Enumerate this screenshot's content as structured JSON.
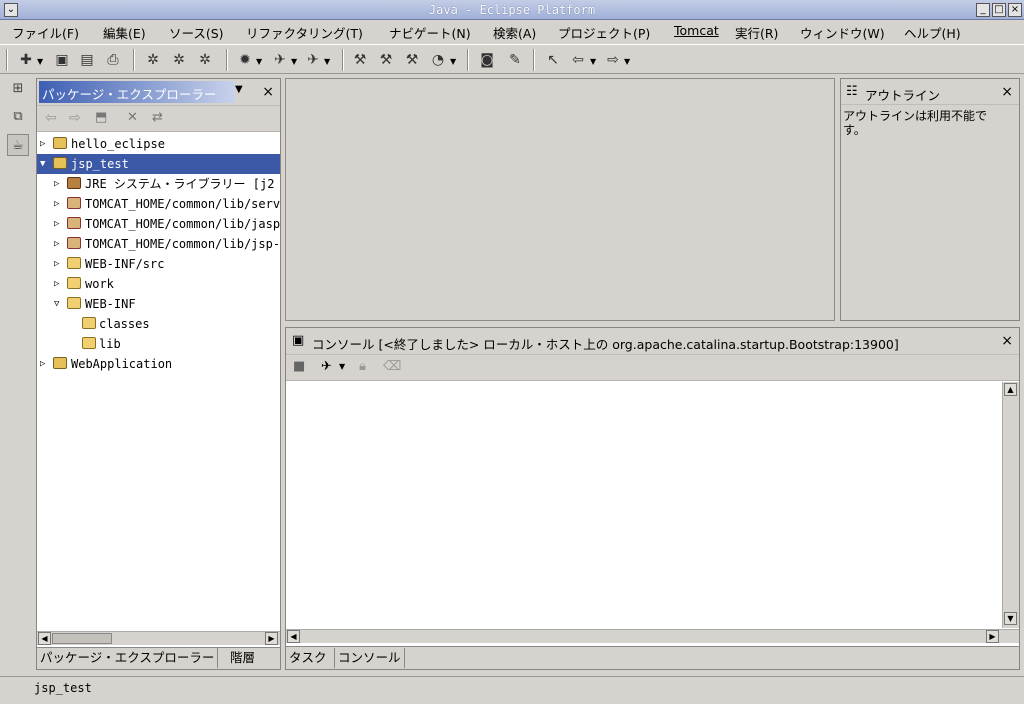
{
  "window": {
    "title": "Java - Eclipse Platform"
  },
  "menubar": {
    "items": [
      "ファイル(F)",
      "編集(E)",
      "ソース(S)",
      "リファクタリング(T)",
      "ナビゲート(N)",
      "検索(A)",
      "プロジェクト(P)",
      "Tomcat",
      "実行(R)",
      "ウィンドウ(W)",
      "ヘルプ(H)"
    ]
  },
  "package_explorer": {
    "title": "パッケージ・エクスプローラー",
    "tree": [
      {
        "label": "hello_eclipse",
        "level": 0,
        "expanded": false,
        "icon": "project-folder-icon"
      },
      {
        "label": "jsp_test",
        "level": 0,
        "expanded": true,
        "selected": true,
        "icon": "project-folder-icon"
      },
      {
        "label": "JRE システム・ライブラリー [j2",
        "level": 1,
        "expanded": false,
        "icon": "library-icon"
      },
      {
        "label": "TOMCAT_HOME/common/lib/servl",
        "level": 1,
        "expanded": false,
        "icon": "jar-icon"
      },
      {
        "label": "TOMCAT_HOME/common/lib/jaspe",
        "level": 1,
        "expanded": false,
        "icon": "jar-icon"
      },
      {
        "label": "TOMCAT_HOME/common/lib/jsp-a",
        "level": 1,
        "expanded": false,
        "icon": "jar-icon"
      },
      {
        "label": "WEB-INF/src",
        "level": 1,
        "expanded": false,
        "icon": "package-folder-icon"
      },
      {
        "label": "work",
        "level": 1,
        "expanded": false,
        "icon": "package-folder-icon"
      },
      {
        "label": "WEB-INF",
        "level": 1,
        "expanded": true,
        "icon": "open-folder-icon"
      },
      {
        "label": "classes",
        "level": 2,
        "icon": "folder-icon"
      },
      {
        "label": "lib",
        "level": 2,
        "icon": "folder-icon"
      },
      {
        "label": "WebApplication",
        "level": 0,
        "expanded": false,
        "icon": "project-folder-icon"
      }
    ],
    "tabs": [
      "パッケージ・エクスプローラー",
      "階層"
    ]
  },
  "outline": {
    "title": "アウトライン",
    "message_line1": "アウトラインは利用不能で",
    "message_line2": "す。"
  },
  "console": {
    "title": "コンソール [<終了しました> ローカル・ホスト上の org.apache.catalina.startup.Bootstrap:13900]",
    "tabs": [
      "タスク",
      "コンソール"
    ]
  },
  "statusbar": {
    "text": "jsp_test"
  },
  "colors": {
    "selection": "#3b59a6",
    "title_gradient": "#9fb0d8"
  }
}
